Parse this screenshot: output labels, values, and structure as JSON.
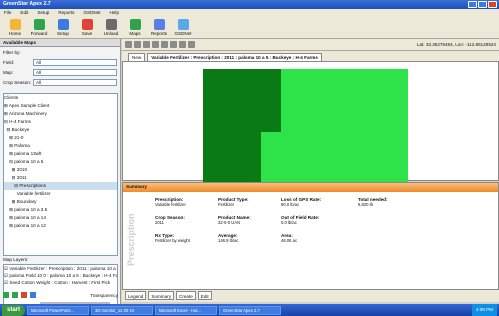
{
  "window": {
    "title": "GreenStar Apex 2.7"
  },
  "menu": [
    "File",
    "Edit",
    "Setup",
    "Reports",
    "GSDNet",
    "Help"
  ],
  "toolbar": [
    {
      "label": "Home",
      "color": "#f4b43a",
      "icon": "home-icon"
    },
    {
      "label": "Forward",
      "color": "#2ea44f",
      "icon": "forward-icon"
    },
    {
      "label": "Setup",
      "color": "#3d7be0",
      "icon": "setup-icon"
    },
    {
      "label": "Save",
      "color": "#e3423b",
      "icon": "save-icon"
    },
    {
      "label": "Unload",
      "color": "#6b6b6b",
      "icon": "unload-icon"
    },
    {
      "label": "Maps",
      "color": "#2fa14f",
      "icon": "maps-icon"
    },
    {
      "label": "Reports",
      "color": "#5a7ee3",
      "icon": "reports-icon"
    },
    {
      "label": "GSDNet",
      "color": "#5aa8e8",
      "icon": "gsdnet-icon"
    }
  ],
  "left": {
    "header": "Available Maps",
    "filter_label": "Filter by:",
    "filters": [
      {
        "label": "Field:",
        "value": "All"
      },
      {
        "label": "Map:",
        "value": "All"
      },
      {
        "label": "Crop Season:",
        "value": "All"
      }
    ],
    "tree": [
      "Clients",
      "⊞ Apex Sample Client",
      "⊞ Arizona Machinery",
      "⊟ H-4 Farms",
      "  ⊟ Buckeye",
      "    ⊞ 21-0",
      "    ⊞ Paloma",
      "    ⊞ paloma 13wft",
      "    ⊟ paloma 10 a 5",
      "      ⊞ 2010",
      "      ⊟ 2011",
      "        ⊟ Prescriptions",
      "          Variable fertilizer",
      "      ⊞ Boundary",
      "    ⊞ paloma 10 a 3.5",
      "    ⊞ paloma 10 a 14",
      "    ⊞ paloma 10 a 12"
    ],
    "layers_label": "Map Layers:",
    "layers": [
      "Variable Fertilizer : Prescription : 2011 : paloma 10 a 5",
      "paloma Field 10 0 : paloma 10 a 5 : Buckeye : H-4 Farms",
      "Seed Cotton Weight : Cotton : Harvest : First Pick"
    ],
    "transparency_label": "Transparency"
  },
  "mapbar": {
    "coords": "Lat: 33.36279484, Lon: -112.86129524"
  },
  "tabs": [
    {
      "label": "New",
      "active": false
    },
    {
      "label": "Variable Fertilizer : Prescription : 2011 : paloma 10 a 5 : Buckeye : H-4 Farms",
      "active": true
    }
  ],
  "map_colors": {
    "bright": "#2ee24a",
    "dark": "#0a7a14"
  },
  "summary": {
    "title": "Summary",
    "vertical": "Prescription",
    "cells": [
      {
        "k": "Prescription:",
        "v": "Variable fertilizer",
        "col": 0,
        "row": 0
      },
      {
        "k": "Product Type:",
        "v": "Fertilizer",
        "col": 1,
        "row": 0
      },
      {
        "k": "Loss of GPS Rate:",
        "v": "90.0 lb/ac",
        "col": 2,
        "row": 0
      },
      {
        "k": "Total needed:",
        "v": "6,820 lb",
        "col": 3,
        "row": 0
      },
      {
        "k": "Crop Season:",
        "v": "2011",
        "col": 0,
        "row": 1
      },
      {
        "k": "Product Name:",
        "v": "32-0-0 UAN",
        "col": 1,
        "row": 1
      },
      {
        "k": "Out of Field Rate:",
        "v": "0.0 lb/ac",
        "col": 2,
        "row": 1
      },
      {
        "k": "Rx Type:",
        "v": "Fertilizer by weight",
        "col": 0,
        "row": 2
      },
      {
        "k": "Average:",
        "v": "146.9 lb/ac",
        "col": 1,
        "row": 2
      },
      {
        "k": "Area:",
        "v": "46.06 ac",
        "col": 2,
        "row": 2
      }
    ]
  },
  "bottom_tabs": [
    "Legend",
    "Summary",
    "Create",
    "Edit"
  ],
  "taskbar": {
    "start": "start",
    "tasks": [
      "Microsoft PowerPoint...",
      "3D monitor_11-20-10",
      "Microsoft Excel - Har...",
      "GreenStar Apex 2.7"
    ],
    "time": "4:08 PM"
  }
}
